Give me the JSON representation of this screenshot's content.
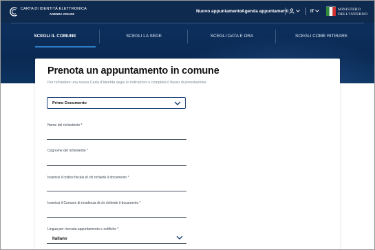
{
  "header": {
    "brand_line1": "CARTA DI IDENTITÀ ELETTRONICA",
    "brand_line2": "AGENDA ONLINE",
    "nav_new": "Nuovo appuntamento",
    "nav_agenda": "Agenda appuntamenti",
    "lang": "IT",
    "ministry_line1": "MINISTERO",
    "ministry_line2": "DELL'INTERNO",
    "bg_color": "#0f2a4f"
  },
  "steps": [
    {
      "label": "SCEGLI IL COMUNE",
      "active": true
    },
    {
      "label": "SCEGLI LA SEDE",
      "active": false
    },
    {
      "label": "SCEGLI DATA E ORA",
      "active": false
    },
    {
      "label": "SCEGLI COME RITIRARE",
      "active": false
    }
  ],
  "form": {
    "title": "Prenota un appuntamento in comune",
    "intro": "Per richiedere una nuova Carta d'Identità segui le indicazioni e completa il flusso di prenotazione.",
    "document_type": "Primo Documento",
    "fields": [
      {
        "label": "Nome del richiedente *",
        "value": ""
      },
      {
        "label": "Cognome del richiedente *",
        "value": ""
      },
      {
        "label": "Inserisci il codice fiscale di chi richiede il documento *",
        "value": ""
      },
      {
        "label": "Inserisci il Comune di residenza di chi richiede il documento *",
        "value": ""
      }
    ],
    "language_label": "Lingua per ricevuta appuntamento e notifiche *",
    "language_value": "Italiano",
    "accent_color": "#1a3f73"
  }
}
